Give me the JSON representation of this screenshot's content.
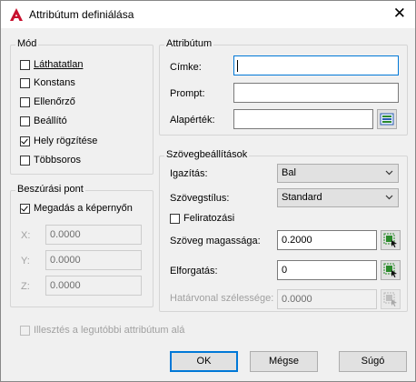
{
  "window": {
    "title": "Attribútum definiálása",
    "close_glyph": "✕"
  },
  "mode": {
    "group_label": "Mód",
    "invisible": {
      "label": "Láthatatlan",
      "checked": false
    },
    "constant": {
      "label": "Konstans",
      "checked": false
    },
    "verify": {
      "label": "Ellenőrző",
      "checked": false
    },
    "preset": {
      "label": "Beállító",
      "checked": false
    },
    "lock_position": {
      "label": "Hely rögzítése",
      "checked": true
    },
    "multiple_lines": {
      "label": "Többsoros",
      "checked": false
    }
  },
  "insertion": {
    "group_label": "Beszúrási pont",
    "specify_on_screen": {
      "label": "Megadás a képernyőn",
      "checked": true
    },
    "x": {
      "label": "X:",
      "value": "0.0000"
    },
    "y": {
      "label": "Y:",
      "value": "0.0000"
    },
    "z": {
      "label": "Z:",
      "value": "0.0000"
    }
  },
  "attribute": {
    "group_label": "Attribútum",
    "tag_label": "Címke:",
    "tag_value": "",
    "prompt_label": "Prompt:",
    "prompt_value": "",
    "default_label": "Alapérték:",
    "default_value": ""
  },
  "text_settings": {
    "group_label": "Szövegbeállítások",
    "justification_label": "Igazítás:",
    "justification_value": "Bal",
    "style_label": "Szövegstílus:",
    "style_value": "Standard",
    "annotative": {
      "label": "Feliratozási",
      "checked": false
    },
    "height_label": "Szöveg magassága:",
    "height_value": "0.2000",
    "rotation_label": "Elforgatás:",
    "rotation_value": "0",
    "boundary_label": "Határvonal szélessége:",
    "boundary_value": "0.0000"
  },
  "align_below": {
    "label": "Illesztés a legutóbbi attribútum alá",
    "checked": false
  },
  "buttons": {
    "ok": "OK",
    "cancel": "Mégse",
    "help": "Súgó"
  }
}
